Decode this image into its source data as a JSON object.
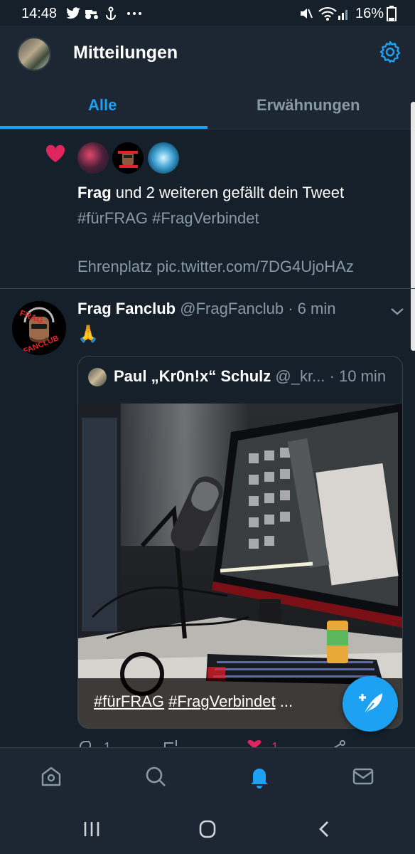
{
  "status_bar": {
    "time": "14:48",
    "left_icons": [
      "twitter-icon",
      "tractor-icon",
      "anchor-icon",
      "more-dots-icon"
    ],
    "battery": "16%"
  },
  "header": {
    "title": "Mitteilungen",
    "tabs": [
      {
        "label": "Alle",
        "active": true
      },
      {
        "label": "Erwähnungen",
        "active": false
      }
    ]
  },
  "like_notification": {
    "actor": "Frag",
    "text_rest": " und 2 weiteren gefällt dein Tweet",
    "hashtags": "#fürFRAG #FragVerbindet",
    "link_text": "Ehrenplatz pic.twitter.com/7DG4UjoHAz"
  },
  "tweet": {
    "name": "Frag Fanclub",
    "handle": "@FragFanclub",
    "separator": "·",
    "time": "6 min",
    "body": "🙏",
    "avatar_text_top": "FRAG",
    "avatar_text_bottom": "FANCLUB",
    "quote": {
      "name": "Paul „Kr0n!x“ Schulz",
      "handle": "@_kr...",
      "separator": "·",
      "time": "10 min",
      "caption_tag1": "#fürFRAG",
      "caption_tag2": "#FragVerbindet",
      "caption_ellipsis": "..."
    },
    "actions": {
      "reply_count": "1",
      "like_count": "1"
    }
  },
  "colors": {
    "accent": "#1da1f2",
    "background": "#15202b",
    "surface": "#1c2733",
    "like": "#e0245e"
  }
}
